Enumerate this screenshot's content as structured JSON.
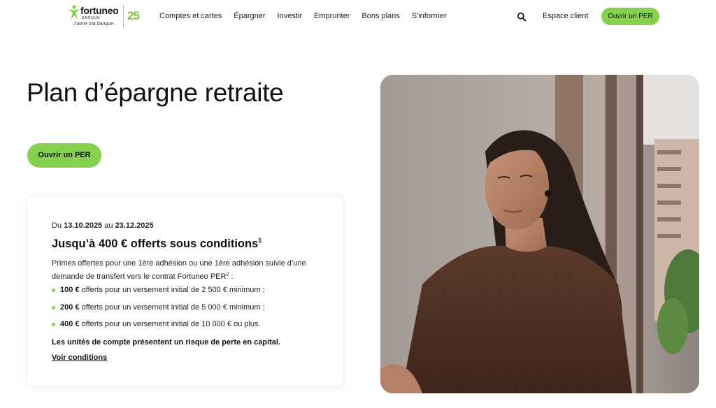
{
  "brand": {
    "name": "fortuneo",
    "sub": "BANQUE",
    "tagline": "J'aime ma banque",
    "anniversary": "25",
    "green": "#86cf4f"
  },
  "nav": {
    "items": [
      {
        "label": "Comptes et cartes"
      },
      {
        "label": "Épargner"
      },
      {
        "label": "Investir"
      },
      {
        "label": "Emprunter"
      },
      {
        "label": "Bons plans"
      },
      {
        "label": "S'informer"
      }
    ],
    "search_icon": "search-icon",
    "espace_label": "Espace client",
    "cta_label": "Ouvrir un PER"
  },
  "hero": {
    "title": "Plan d’épargne retraite",
    "cta_label": "Ouvrir un PER",
    "image_alt": "woman-portrait"
  },
  "offer": {
    "dates_prefix": "Du",
    "date_from": "13.10.2025",
    "dates_mid": "au",
    "date_to": "23.12.2025",
    "headline": "Jusqu’à 400 € offerts sous conditions",
    "headline_note": "1",
    "intro": "Primes offertes pour une 1ère adhésion ou une 1ère adhésion suivie d’une demande de transfert vers le contrat Fortuneo PER",
    "intro_note": "2",
    "intro_end": " :",
    "bullets": [
      {
        "amount": "100 €",
        "text": " offerts pour un versement initial de 2 500 € minimum ;"
      },
      {
        "amount": "200 €",
        "text": " offerts pour un versement initial de 5 000 € minimum ;"
      },
      {
        "amount": "400 €",
        "text": " offerts pour un versement initial de 10 000 € ou plus."
      }
    ],
    "risk": "Les unités de compte présentent un risque de perte en capital.",
    "conditions_link": "Voir conditions"
  }
}
